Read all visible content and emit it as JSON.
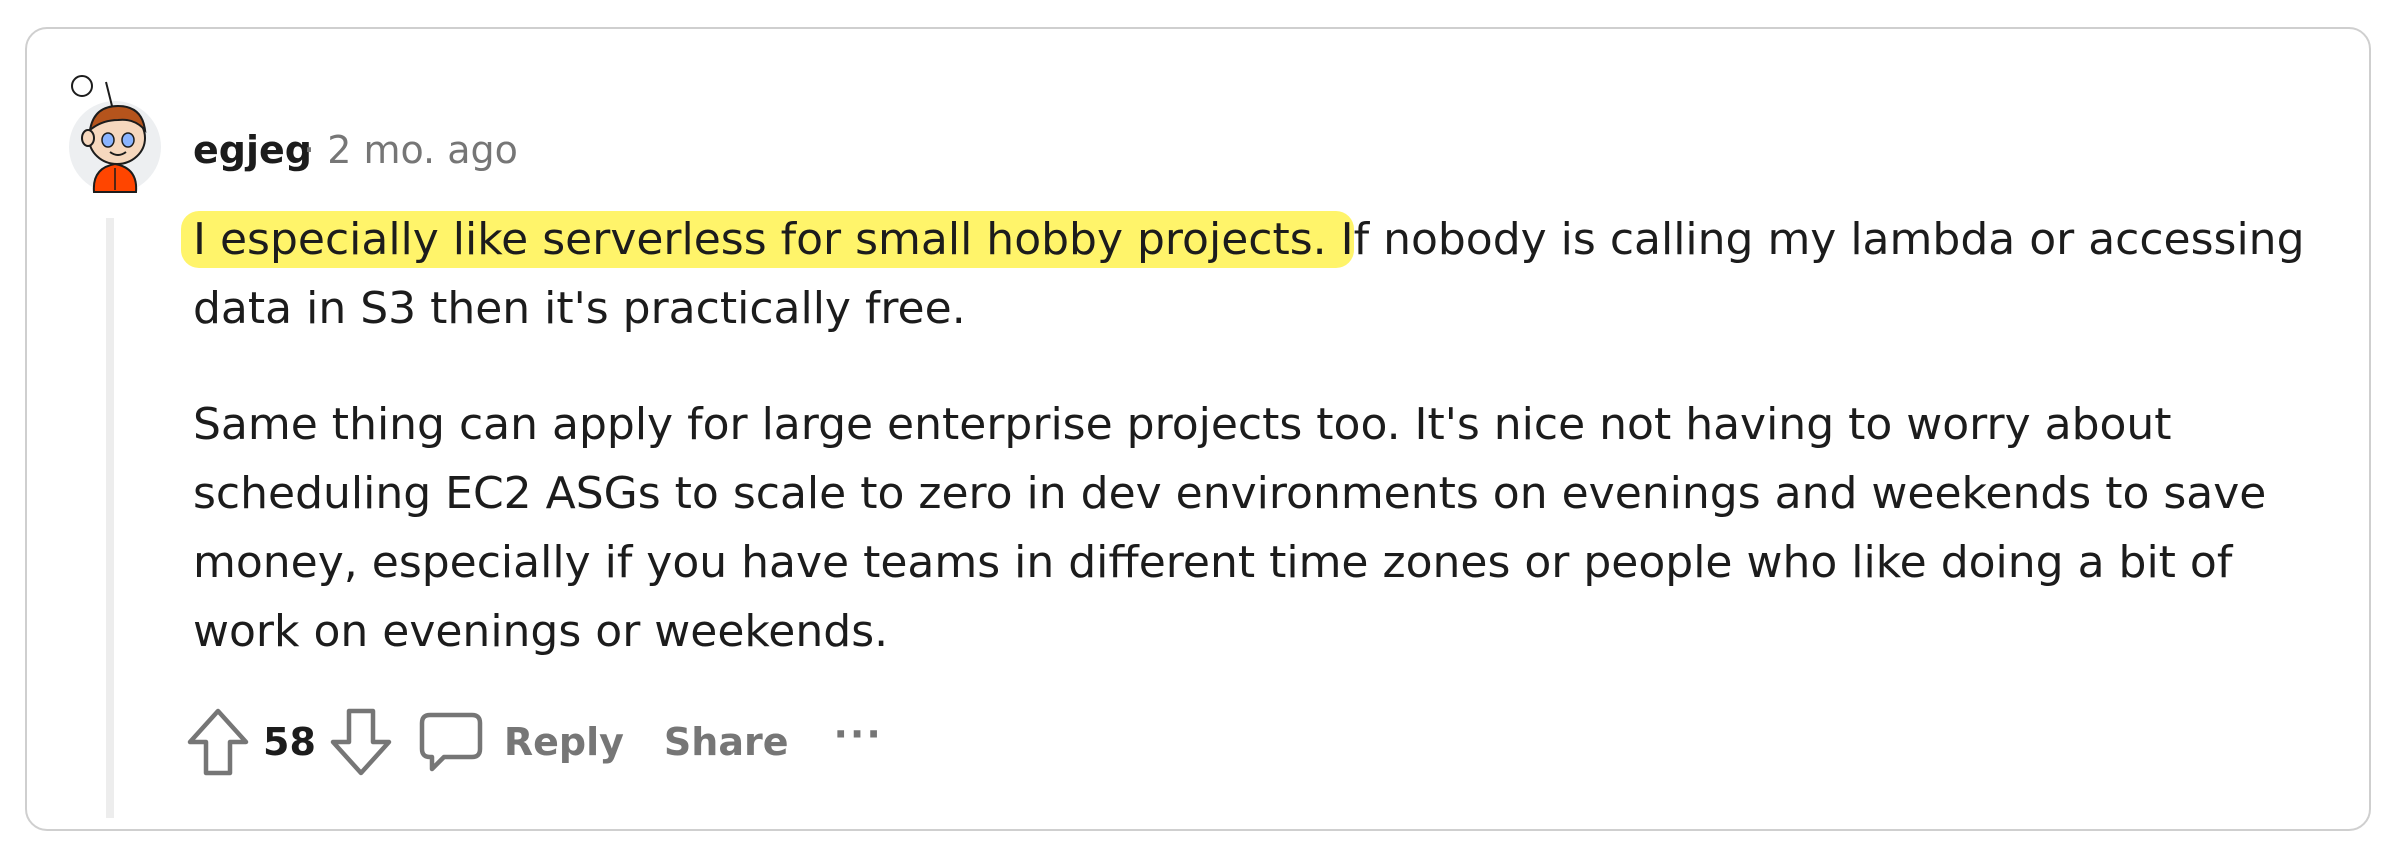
{
  "comment": {
    "username": "egjeg",
    "separator": "·",
    "timestamp": "2 mo. ago",
    "highlighted_text": "I especially like serverless for small hobby projects. I",
    "paragraph1_rest": "f nobody is calling my lambda or accessing data in S3 then it's practically free.",
    "paragraph2": "Same thing can apply for large enterprise projects too. It's nice not having to worry about scheduling EC2 ASGs to scale to zero in dev environments on evenings and weekends to save money, especially if you have teams in different time zones or people who like doing a bit of work on evenings or weekends.",
    "highlight_color": "#fff46a"
  },
  "actions": {
    "vote_count": "58",
    "reply_label": "Reply",
    "share_label": "Share",
    "more_label": "···"
  },
  "icons": {
    "upvote": "arrow-up-outline-icon",
    "downvote": "arrow-down-outline-icon",
    "comment": "speech-bubble-icon",
    "avatar": "snoo-avatar"
  }
}
